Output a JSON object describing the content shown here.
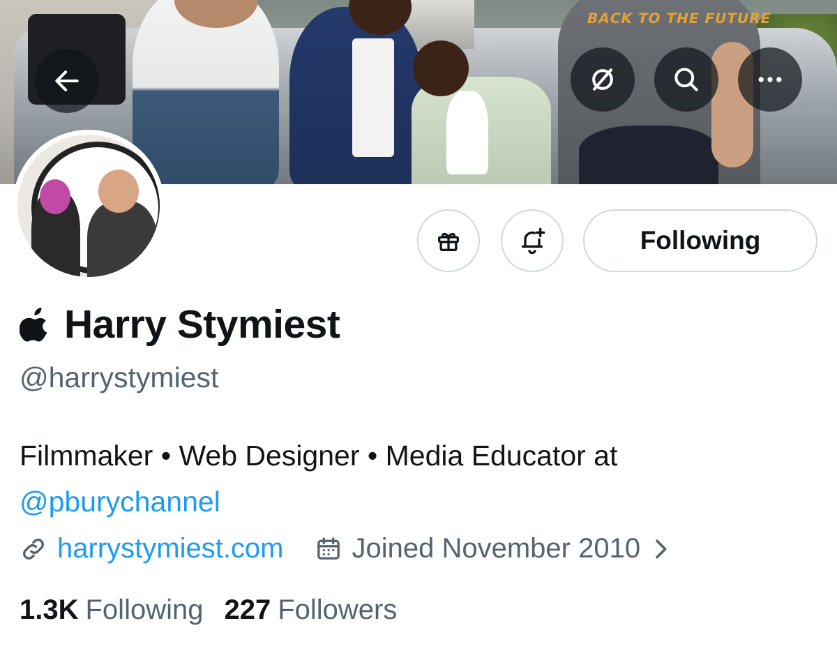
{
  "header": {
    "back_icon": "arrow-left-icon",
    "grok_icon": "grok-icon",
    "search_icon": "search-icon",
    "more_icon": "more-horizontal-icon",
    "banner_shirt_text": "BACK TO THE FUTURE"
  },
  "actions": {
    "gift_icon": "gift-icon",
    "notify_icon": "bell-plus-icon",
    "follow_label": "Following"
  },
  "profile": {
    "badge_icon": "apple-logo-icon",
    "display_name": "Harry Stymiest",
    "handle": "@harrystymiest",
    "bio_text": "Filmmaker • Web Designer • Media Educator at",
    "bio_mention": "@pburychannel",
    "website": "harrystymiest.com",
    "joined": "Joined November 2010"
  },
  "stats": {
    "following_count": "1.3K",
    "following_label": "Following",
    "followers_count": "227",
    "followers_label": "Followers"
  },
  "colors": {
    "text_primary": "#0f1419",
    "text_secondary": "#536471",
    "link": "#1d9bf0",
    "border": "#cfd9de"
  }
}
